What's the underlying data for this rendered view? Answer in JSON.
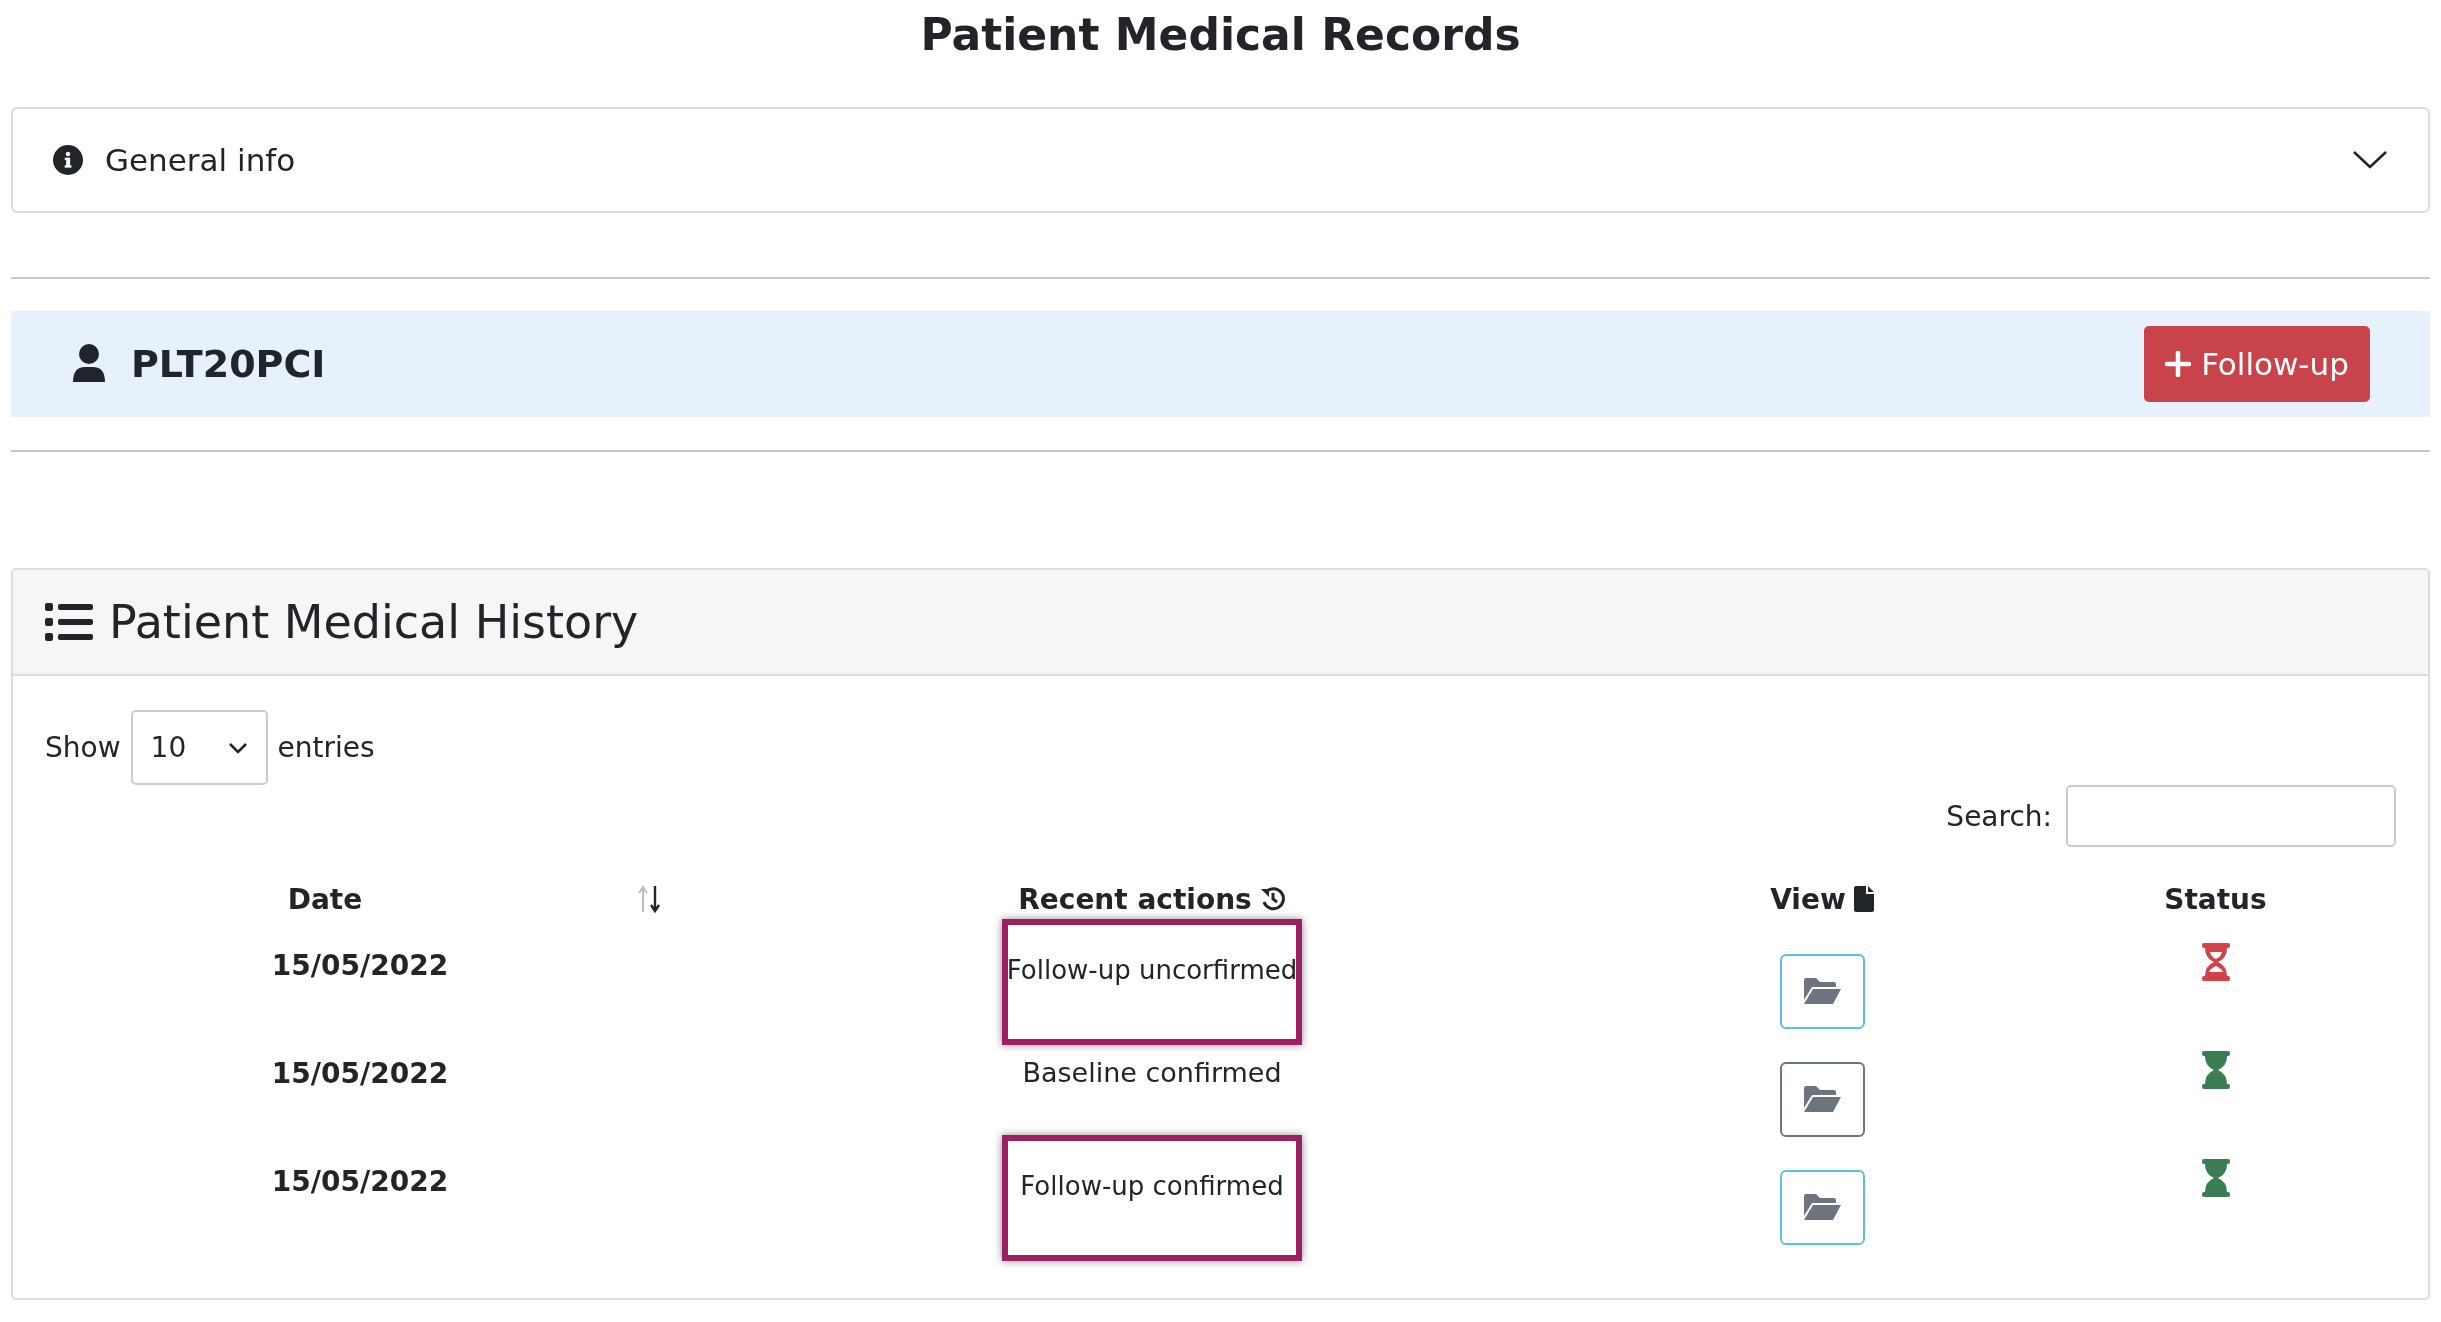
{
  "page_title": "Patient Medical Records",
  "general_info": {
    "label": "General info",
    "expanded": false
  },
  "patient": {
    "id": "PLT20PCI",
    "button": "Follow-up"
  },
  "history": {
    "title": "Patient Medical History",
    "show_label": "Show",
    "entries_value": "10",
    "entries_label": "entries",
    "search_label": "Search:",
    "columns": [
      "Date",
      "Recent actions",
      "View",
      "Status"
    ],
    "rows": [
      {
        "date": "15/05/2022",
        "action": "Follow-up uncorfirmed",
        "highlighted": true,
        "view_selected": false,
        "kind": "half",
        "color": "#d0434b"
      },
      {
        "date": "15/05/2022",
        "action": "Baseline confirmed",
        "highlighted": false,
        "view_selected": true,
        "kind": "full",
        "color": "#3a7d52"
      },
      {
        "date": "15/05/2022",
        "action": "Follow-up confirmed",
        "highlighted": true,
        "view_selected": false,
        "kind": "full",
        "color": "#3a7d52"
      }
    ]
  }
}
